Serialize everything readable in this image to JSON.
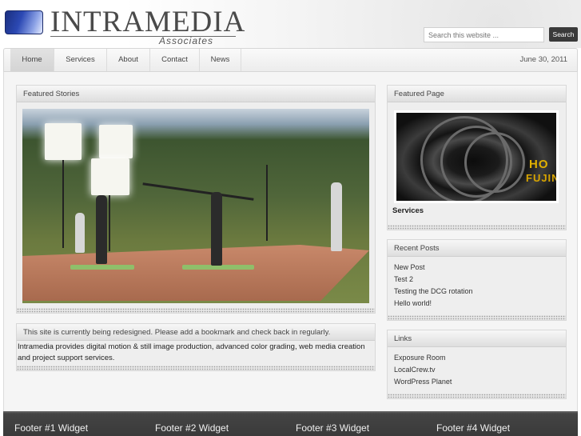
{
  "site": {
    "logo_name": "INTRAMEDIA",
    "logo_sub": "Associates"
  },
  "search": {
    "placeholder": "Search this website ...",
    "button_label": "Search"
  },
  "nav": {
    "items": [
      {
        "label": "Home",
        "active": true
      },
      {
        "label": "Services",
        "active": false
      },
      {
        "label": "About",
        "active": false
      },
      {
        "label": "Contact",
        "active": false
      },
      {
        "label": "News",
        "active": false
      }
    ],
    "date": "June 30, 2011"
  },
  "featured_stories": {
    "title": "Featured Stories"
  },
  "notice": {
    "title": "This site is currently being redesigned. Please add a bookmark and check back in regularly.",
    "body": "Intramedia provides digital motion & still image production, advanced color grading, web media creation and project support services."
  },
  "featured_page": {
    "title": "Featured Page",
    "caption": "Services",
    "image_text_1": "HO",
    "image_text_2": "FUJINO"
  },
  "recent_posts": {
    "title": "Recent Posts",
    "items": [
      "New Post",
      "Test 2",
      "Testing the DCG rotation",
      "Hello world!"
    ]
  },
  "links": {
    "title": "Links",
    "items": [
      "Exposure Room",
      "LocalCrew.tv",
      "WordPress Planet"
    ]
  },
  "footer": {
    "widgets": [
      "Footer #1 Widget",
      "Footer #2 Widget",
      "Footer #3 Widget",
      "Footer #4 Widget"
    ]
  },
  "colors": {
    "nav_bg": "#ececec",
    "footer_bg": "#3a3a3a",
    "search_button_bg": "#3a3a3a",
    "logo_blue": "#2c49b4"
  }
}
